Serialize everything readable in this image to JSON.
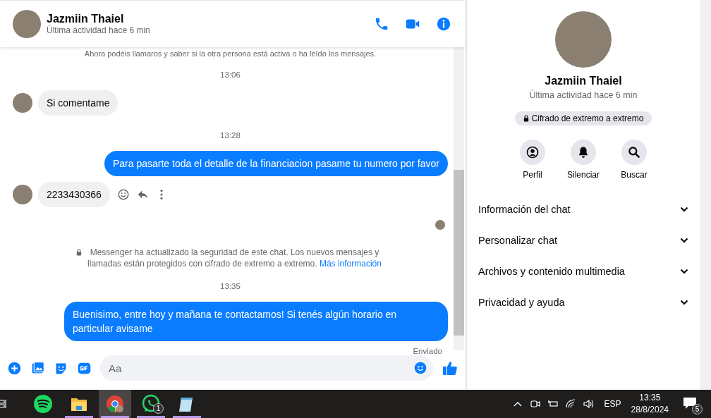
{
  "header": {
    "name": "Jazmiin Thaiel",
    "status": "Última actividad hace 6 min"
  },
  "messages": [
    {
      "kind": "notice",
      "text": "Ahora podéis llamaros y saber si la otra persona está activa o ha leído los mensajes."
    },
    {
      "kind": "time",
      "text": "13:06"
    },
    {
      "kind": "incoming",
      "text": "Si comentame",
      "actions": false
    },
    {
      "kind": "time",
      "text": "13:28"
    },
    {
      "kind": "outgoing",
      "text": "Para pasarte toda el detalle de la financiacion pasame tu numero por favor"
    },
    {
      "kind": "incoming",
      "text": "2233430366",
      "actions": true
    },
    {
      "kind": "seen"
    },
    {
      "kind": "security",
      "text": "Messenger ha actualizado la seguridad de este chat. Los nuevos mensajes y llamadas están protegidos con cifrado de extremo a extremo.",
      "link": "Más información"
    },
    {
      "kind": "time",
      "text": "13:35"
    },
    {
      "kind": "outgoing",
      "text": "Buenisimo, entre hoy y mañana te contactamos! Si tenés algún horario en particular avisame"
    },
    {
      "kind": "status",
      "text": "Enviado"
    }
  ],
  "composer": {
    "placeholder": "Aa"
  },
  "profile": {
    "name": "Jazmiin Thaiel",
    "status": "Última actividad hace 6 min",
    "encryption": "Cifrado de extremo a extremo",
    "actions": [
      {
        "kind": "profile",
        "label": "Perfil"
      },
      {
        "kind": "mute",
        "label": "Silenciar"
      },
      {
        "kind": "search",
        "label": "Buscar"
      }
    ],
    "sections": [
      {
        "label": "Información del chat",
        "expanded": false
      },
      {
        "label": "Personalizar chat",
        "expanded": false
      },
      {
        "label": "Archivos y contenido multimedia",
        "expanded": false
      },
      {
        "label": "Privacidad y ayuda",
        "expanded": false
      }
    ]
  },
  "taskbar": {
    "apps": [
      {
        "kind": "spotify",
        "running": false,
        "selected": false
      },
      {
        "kind": "files",
        "running": true,
        "selected": false
      },
      {
        "kind": "browser",
        "running": true,
        "selected": true
      },
      {
        "kind": "whatsapp",
        "running": true,
        "selected": false,
        "badge": "1"
      },
      {
        "kind": "notepad",
        "running": true,
        "selected": false
      }
    ],
    "language": "ESP",
    "time": "13:35",
    "date": "28/8/2024",
    "notifications": "5"
  }
}
